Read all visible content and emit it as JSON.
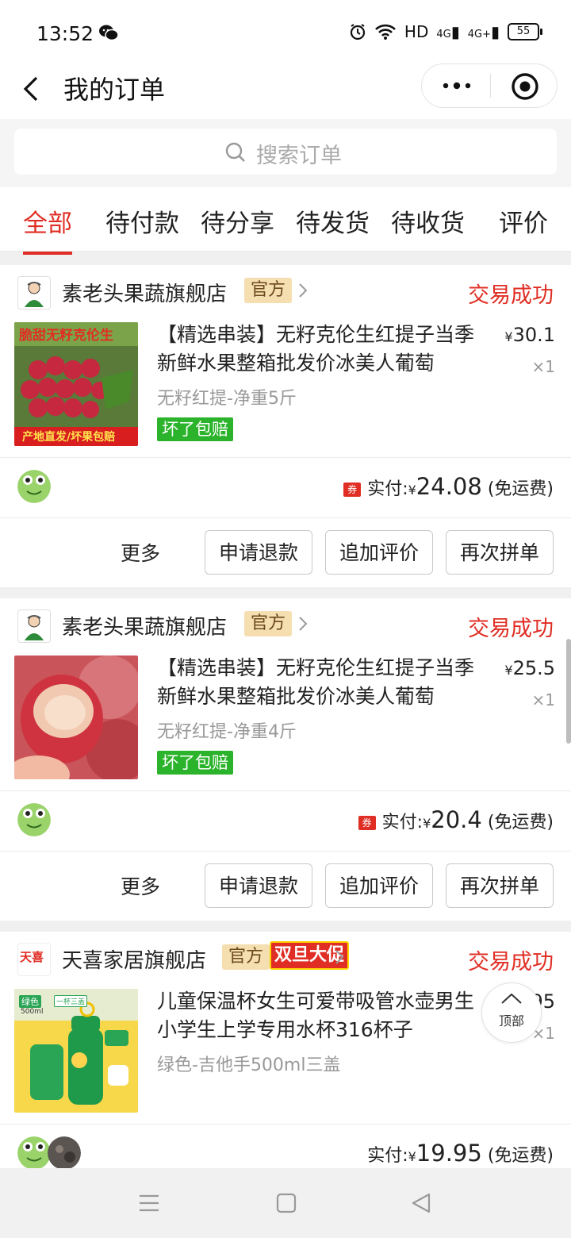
{
  "status_bar": {
    "time": "13:52",
    "network": "HD",
    "signal1": "4G",
    "signal2": "4G+",
    "battery": "55"
  },
  "header": {
    "title": "我的订单",
    "capsule_more_icon": "more-dots-icon",
    "capsule_close_icon": "target-icon"
  },
  "search": {
    "placeholder": "搜索订单"
  },
  "tabs": [
    {
      "label": "全部",
      "active": true
    },
    {
      "label": "待付款"
    },
    {
      "label": "待分享"
    },
    {
      "label": "待发货"
    },
    {
      "label": "待收货"
    },
    {
      "label": "评价"
    }
  ],
  "orders": [
    {
      "shop": "素老头果蔬旗舰店",
      "badge": "官方",
      "status": "交易成功",
      "title": "【精选串装】无籽克伦生红提子当季新鲜水果整箱批发价冰美人葡萄",
      "price": "30.1",
      "currency": "¥",
      "qty": "×1",
      "spec": "无籽红提-净重5斤",
      "tag": "坏了包赔",
      "thumb_text_top": "脆甜无籽克伦生",
      "thumb_text_bottom": "产地直发/坏果包赔",
      "coupon": "券",
      "paid_label": "实付:",
      "paid_amount": "24.08",
      "shipping": "(免运费)",
      "actions": {
        "more": "更多",
        "refund": "申请退款",
        "review": "追加评价",
        "rebuy": "再次拼单"
      }
    },
    {
      "shop": "素老头果蔬旗舰店",
      "badge": "官方",
      "status": "交易成功",
      "title": "【精选串装】无籽克伦生红提子当季新鲜水果整箱批发价冰美人葡萄",
      "price": "25.5",
      "currency": "¥",
      "qty": "×1",
      "spec": "无籽红提-净重4斤",
      "tag": "坏了包赔",
      "coupon": "券",
      "paid_label": "实付:",
      "paid_amount": "20.4",
      "shipping": "(免运费)",
      "actions": {
        "more": "更多",
        "refund": "申请退款",
        "review": "追加评价",
        "rebuy": "再次拼单"
      }
    },
    {
      "shop": "天喜家居旗舰店",
      "shop_logo_text": "天喜",
      "badge": "官方",
      "promo": "双旦大促",
      "status": "交易成功",
      "title": "儿童保温杯女生可爱带吸管水壶男生小学生上学专用水杯316杯子",
      "price_partial": "95",
      "qty": "×1",
      "spec": "绿色-吉他手500ml三盖",
      "thumb_label": "绿色",
      "thumb_sub": "500ml",
      "thumb_tag": "一杯三盖",
      "paid_label": "实付:",
      "paid_amount": "19.95",
      "currency": "¥",
      "shipping": "(免运费)"
    }
  ],
  "to_top": {
    "label": "顶部",
    "icon": "chevron-up-icon"
  },
  "system_nav": {
    "menu": "menu-icon",
    "home": "home-square-icon",
    "back": "back-triangle-icon"
  }
}
